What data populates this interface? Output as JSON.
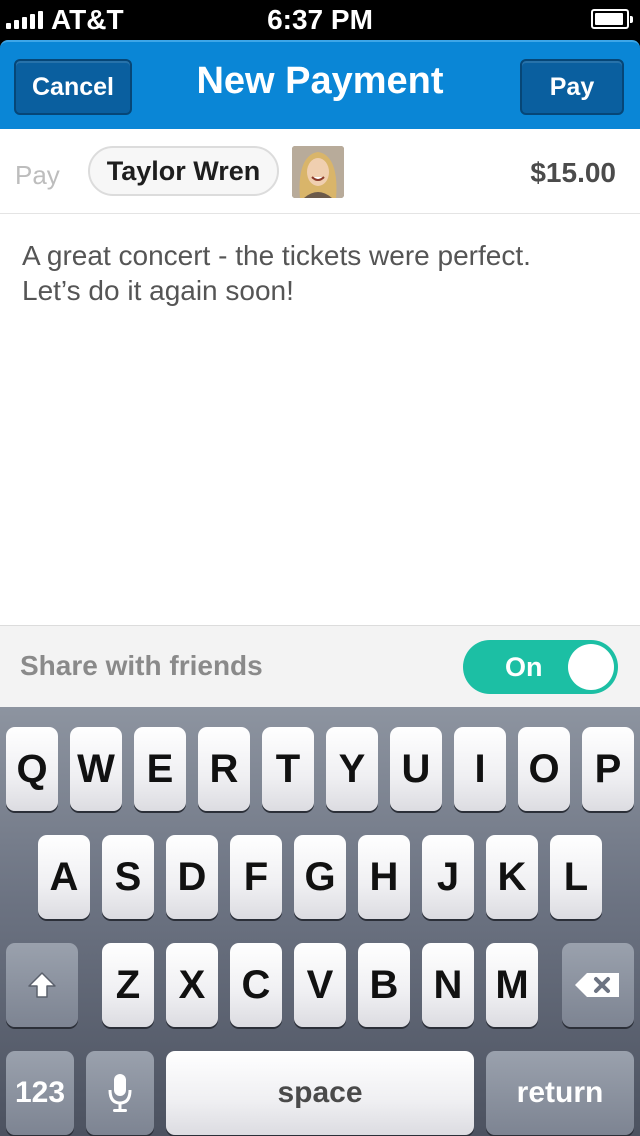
{
  "status_bar": {
    "carrier": "AT&T",
    "time": "6:37 PM"
  },
  "nav": {
    "cancel_label": "Cancel",
    "title": "New Payment",
    "pay_label": "Pay"
  },
  "payment": {
    "action_label": "Pay",
    "recipient": "Taylor Wren",
    "amount": "$15.00"
  },
  "note": {
    "text": "A great concert - the tickets were perfect.\nLet’s do it again soon!"
  },
  "share": {
    "label": "Share with friends",
    "toggle_label": "On",
    "enabled": true
  },
  "keyboard": {
    "row1": [
      "Q",
      "W",
      "E",
      "R",
      "T",
      "Y",
      "U",
      "I",
      "O",
      "P"
    ],
    "row2": [
      "A",
      "S",
      "D",
      "F",
      "G",
      "H",
      "J",
      "K",
      "L"
    ],
    "row3": [
      "Z",
      "X",
      "C",
      "V",
      "B",
      "N",
      "M"
    ],
    "numbers_label": "123",
    "space_label": "space",
    "return_label": "return"
  },
  "colors": {
    "nav_blue": "#0a86d6",
    "toggle_teal": "#1cbfa4"
  }
}
